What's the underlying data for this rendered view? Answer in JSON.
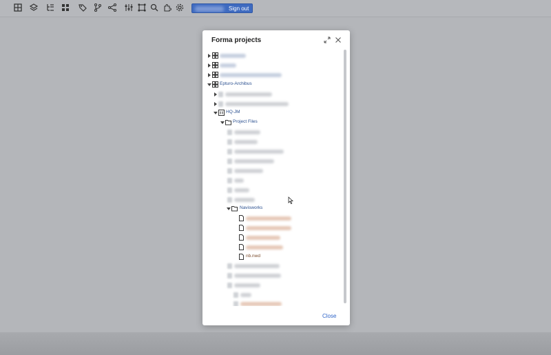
{
  "toolbar": {
    "icons": [
      "grid-icon",
      "layers-icon",
      "tree-list-icon",
      "apps-icon",
      "tag-icon",
      "branch-icon",
      "share-icon",
      "sliders-icon",
      "frame-icon",
      "search-icon",
      "puzzle-icon",
      "gear-icon"
    ],
    "signout_label": "Sign out"
  },
  "dialog": {
    "title": "Forma projects",
    "close_label": "Close",
    "tree": {
      "root_item_4": "Epturo-Archibus",
      "project": "HQ-JM",
      "project_files": "Project Files",
      "navisworks_folder": "Navisworks",
      "nwd_file": "nb.nwd"
    }
  },
  "colors": {
    "accent": "#2d63c8",
    "button": "#3f6bc0",
    "overlay": "#b4b6ba"
  }
}
